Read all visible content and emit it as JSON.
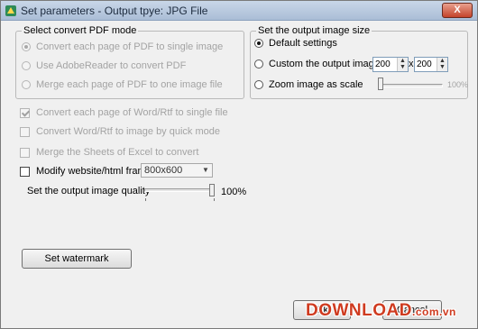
{
  "window": {
    "title": "Set parameters - Output tpye: JPG File",
    "close_glyph": "X"
  },
  "pdf_mode": {
    "title": "Select convert PDF mode",
    "options": [
      {
        "label": "Convert each page of PDF to single image",
        "checked": true,
        "enabled": false
      },
      {
        "label": "Use AdobeReader to convert PDF",
        "checked": false,
        "enabled": false
      },
      {
        "label": "Merge each page of PDF to one image file",
        "checked": false,
        "enabled": false
      }
    ]
  },
  "image_size": {
    "title": "Set the output image size",
    "default_label": "Default settings",
    "custom_label": "Custom the output image size",
    "width_value": "200",
    "times_sign": "x",
    "height_value": "200",
    "zoom_label": "Zoom image as scale",
    "zoom_value": "100%",
    "zoom_fraction": 0.0
  },
  "word_options": [
    {
      "label": "Convert each page of Word/Rtf to single file",
      "checked": true,
      "enabled": false
    },
    {
      "label": "Convert Word/Rtf to image by quick mode",
      "checked": false,
      "enabled": false
    },
    {
      "label": "Merge the Sheets of Excel to convert",
      "checked": false,
      "enabled": false
    }
  ],
  "website": {
    "label": "Modify website/html frame",
    "checked": false,
    "frame_size": "800x600"
  },
  "quality": {
    "label": "Set the output image quality",
    "value": "100%",
    "fraction": 1.0
  },
  "buttons": {
    "set_watermark": "Set watermark",
    "ok": "Ok",
    "cancel": "Cancel"
  },
  "overlay": {
    "brand": "DOWNLOAD",
    "suffix": ".com.vn"
  },
  "colors": {
    "accent": "#cf3b20",
    "disabled_text": "#a3a3a3"
  }
}
